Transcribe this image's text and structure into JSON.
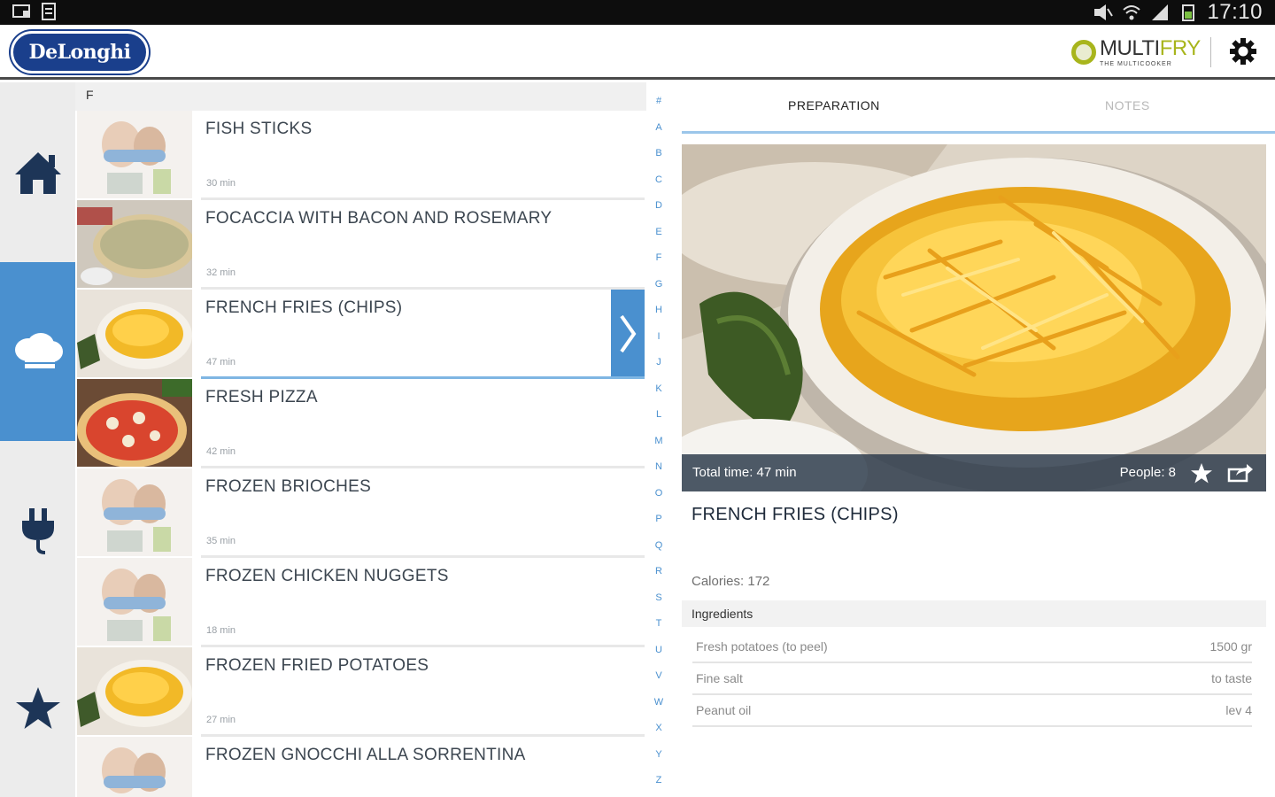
{
  "statusbar": {
    "time": "17:10"
  },
  "header": {
    "brand": "DeLonghi",
    "product_name_a": "MULTI",
    "product_name_b": "FRY",
    "product_tagline": "THE MULTICOOKER"
  },
  "list": {
    "section_letter": "F",
    "items": [
      {
        "name": "FISH STICKS",
        "time": "30 min"
      },
      {
        "name": "FOCACCIA WITH BACON AND ROSEMARY",
        "time": "32 min"
      },
      {
        "name": "FRENCH FRIES (CHIPS)",
        "time": "47 min"
      },
      {
        "name": "FRESH PIZZA",
        "time": "42 min"
      },
      {
        "name": "FROZEN BRIOCHES",
        "time": "35 min"
      },
      {
        "name": "FROZEN CHICKEN NUGGETS",
        "time": "18 min"
      },
      {
        "name": "FROZEN FRIED POTATOES",
        "time": "27 min"
      },
      {
        "name": "FROZEN GNOCCHI ALLA SORRENTINA",
        "time": ""
      }
    ]
  },
  "alphabet": [
    "#",
    "A",
    "B",
    "C",
    "D",
    "E",
    "F",
    "G",
    "H",
    "I",
    "J",
    "K",
    "L",
    "M",
    "N",
    "O",
    "P",
    "Q",
    "R",
    "S",
    "T",
    "U",
    "V",
    "W",
    "X",
    "Y",
    "Z"
  ],
  "detail": {
    "tabs": {
      "preparation": "PREPARATION",
      "notes": "NOTES"
    },
    "total_time": "Total time: 47 min",
    "people": "People: 8",
    "title": "FRENCH FRIES (CHIPS)",
    "calories": "Calories: 172",
    "ingredients_label": "Ingredients",
    "ingredients": [
      {
        "name": "Fresh potatoes (to peel)",
        "qty": "1500 gr"
      },
      {
        "name": "Fine salt",
        "qty": "to taste"
      },
      {
        "name": "Peanut oil",
        "qty": "lev 4"
      }
    ]
  },
  "colors": {
    "accent": "#4a90cf",
    "brand": "#1a3f8c",
    "nav_icon": "#1d3557"
  }
}
